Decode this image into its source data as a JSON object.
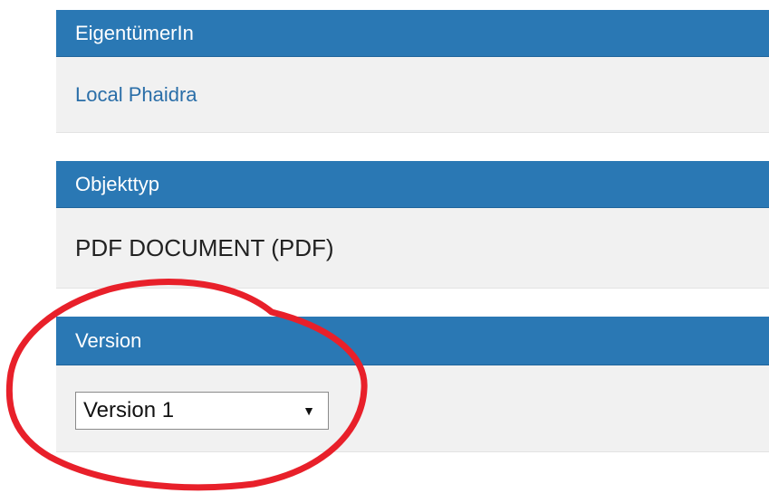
{
  "panels": [
    {
      "title": "EigentümerIn",
      "value": "Local Phaidra"
    },
    {
      "title": "Objekttyp",
      "value": "PDF DOCUMENT (PDF)"
    },
    {
      "title": "Version",
      "select_value": "Version 1"
    }
  ],
  "icons": {
    "dropdown_caret": "chevron-down-icon"
  },
  "colors": {
    "header_bg": "#2a78b4",
    "body_bg": "#f1f1f1",
    "link": "#2a6ea8",
    "annotation": "#e8202a"
  }
}
